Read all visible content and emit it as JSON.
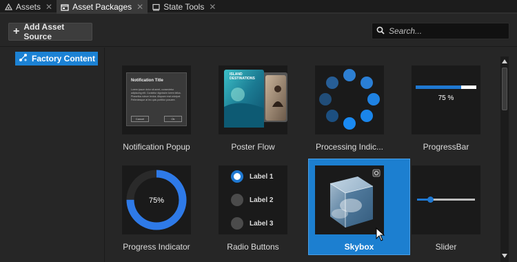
{
  "tabs": [
    {
      "label": "Assets",
      "icon": "assets-icon",
      "active": false
    },
    {
      "label": "Asset Packages",
      "icon": "packages-icon",
      "active": true
    },
    {
      "label": "State Tools",
      "icon": "state-tools-icon",
      "active": false
    }
  ],
  "toolbar": {
    "add_source_label": "Add Asset Source",
    "search_placeholder": "Search..."
  },
  "sidebar": {
    "items": [
      {
        "label": "Factory Content",
        "icon": "factory-content-icon",
        "selected": true
      }
    ]
  },
  "packages": [
    {
      "label": "Notification Popup"
    },
    {
      "label": "Poster Flow"
    },
    {
      "label": "Processing Indic..."
    },
    {
      "label": "ProgressBar"
    },
    {
      "label": "Progress Indicator"
    },
    {
      "label": "Radio Buttons"
    },
    {
      "label": "Skybox",
      "selected": true
    },
    {
      "label": "Slider"
    }
  ],
  "thumbs": {
    "notification": {
      "title": "Notification Title",
      "body": "Lorem ipsum dolor sit amet, consectetur adipiscing elit. Curabitur dignissim lorem tellus. Phasellus rutrum lectus. Aliquam erat volutpat. Pellentesque at leo quis porttitor posuere.",
      "cancel": "Cancel",
      "ok": "Ok"
    },
    "poster": {
      "caption": "ISLAND DESTINATIONS"
    },
    "progress_bar": {
      "value": 0.75,
      "text": "75 %"
    },
    "progress_indicator": {
      "value": 0.75,
      "text": "75%"
    },
    "radio": {
      "labels": [
        "Label 1",
        "Label 2",
        "Label 3"
      ],
      "selected_index": 0
    },
    "slider": {
      "value": 0.23
    }
  },
  "colors": {
    "accent": "#1c82d4",
    "bg": "#262626",
    "thumb_bg": "#1a1a1a"
  }
}
